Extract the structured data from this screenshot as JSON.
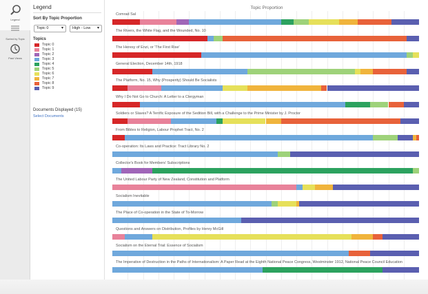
{
  "rail": {
    "legend_label": "Legend",
    "sort_label": "Sorted by Topic",
    "history_label": "Past Views"
  },
  "legend": {
    "title": "Legend",
    "sort_heading": "Sort By Topic Proportion",
    "sort_topic_value": "Topic 0",
    "sort_order_value": "High - Low",
    "topics_heading": "Topics",
    "docs_displayed": "Documents Displayed (15)",
    "select_documents": "Select Documents"
  },
  "topics": [
    {
      "name": "Topic 0",
      "color": "#d62728"
    },
    {
      "name": "Topic 1",
      "color": "#e8829a"
    },
    {
      "name": "Topic 2",
      "color": "#a066b8"
    },
    {
      "name": "Topic 3",
      "color": "#6fa8dc"
    },
    {
      "name": "Topic 4",
      "color": "#2ca25f"
    },
    {
      "name": "Topic 5",
      "color": "#9ed27a"
    },
    {
      "name": "Topic 6",
      "color": "#e6e05a"
    },
    {
      "name": "Topic 7",
      "color": "#f0b43c"
    },
    {
      "name": "Topic 8",
      "color": "#e8623a"
    },
    {
      "name": "Topic 9",
      "color": "#5a5fb0"
    }
  ],
  "main": {
    "heading": "Topic Proportion"
  },
  "chart_data": {
    "type": "bar",
    "stacked": true,
    "orientation": "horizontal",
    "title": "Topic Proportion",
    "xlim": [
      0,
      1
    ],
    "grid": true,
    "documents": [
      {
        "title": "Comrad Sal",
        "segments": [
          [
            0,
            0.09
          ],
          [
            1,
            0.12
          ],
          [
            2,
            0.04
          ],
          [
            3,
            0.3
          ],
          [
            4,
            0.04
          ],
          [
            5,
            0.05
          ],
          [
            6,
            0.1
          ],
          [
            7,
            0.06
          ],
          [
            8,
            0.11
          ],
          [
            9,
            0.09
          ]
        ]
      },
      {
        "title": "The Rivers, the White Flag, and the Wounded, No. 10",
        "segments": [
          [
            0,
            0.31
          ],
          [
            3,
            0.02
          ],
          [
            5,
            0.03
          ],
          [
            8,
            0.6
          ],
          [
            9,
            0.04
          ]
        ]
      },
      {
        "title": "The Heresy of Enzi, or 'The First Rise'",
        "segments": [
          [
            0,
            0.29
          ],
          [
            3,
            0.67
          ],
          [
            5,
            0.02
          ],
          [
            6,
            0.02
          ]
        ]
      },
      {
        "title": "General Election, December 14th, 1918",
        "segments": [
          [
            0,
            0.13
          ],
          [
            3,
            0.31
          ],
          [
            5,
            0.35
          ],
          [
            6,
            0.02
          ],
          [
            7,
            0.04
          ],
          [
            8,
            0.11
          ],
          [
            9,
            0.04
          ]
        ]
      },
      {
        "title": "The Platform, No. 15, Why (Prosperity) Should Be Socialists",
        "segments": [
          [
            0,
            0.05
          ],
          [
            1,
            0.11
          ],
          [
            3,
            0.2
          ],
          [
            6,
            0.08
          ],
          [
            7,
            0.24
          ],
          [
            8,
            0.02
          ],
          [
            9,
            0.3
          ]
        ]
      },
      {
        "title": "Why I Do Not Go to Church: A Letter to a Clergyman",
        "segments": [
          [
            0,
            0.09
          ],
          [
            3,
            0.67
          ],
          [
            4,
            0.08
          ],
          [
            5,
            0.06
          ],
          [
            8,
            0.05
          ],
          [
            9,
            0.05
          ]
        ]
      },
      {
        "title": "Soldiers or Slaves? A Terrific Exposure of the Sedition Bill, with a Challenge to the Prime Minister by J. Proctor",
        "segments": [
          [
            0,
            0.05
          ],
          [
            1,
            0.14
          ],
          [
            3,
            0.15
          ],
          [
            4,
            0.02
          ],
          [
            6,
            0.14
          ],
          [
            7,
            0.05
          ],
          [
            8,
            0.39
          ],
          [
            9,
            0.06
          ]
        ]
      },
      {
        "title": "From Bibles to Religion, Labour Prophet Tract, No. 2",
        "segments": [
          [
            0,
            0.04
          ],
          [
            3,
            0.81
          ],
          [
            5,
            0.08
          ],
          [
            9,
            0.05
          ],
          [
            7,
            0.01
          ],
          [
            8,
            0.01
          ]
        ]
      },
      {
        "title": "Co-operation: Its Laws and Practice: Tract Library No. 2",
        "segments": [
          [
            3,
            0.54
          ],
          [
            5,
            0.04
          ],
          [
            9,
            0.42
          ]
        ]
      },
      {
        "title": "Collector's Book for Members' Subscriptions",
        "segments": [
          [
            3,
            0.03
          ],
          [
            2,
            0.1
          ],
          [
            4,
            0.85
          ],
          [
            5,
            0.02
          ]
        ]
      },
      {
        "title": "The United Labour Party of New Zealand, Constitution and Platform",
        "segments": [
          [
            1,
            0.6
          ],
          [
            3,
            0.02
          ],
          [
            6,
            0.04
          ],
          [
            7,
            0.06
          ],
          [
            9,
            0.28
          ]
        ]
      },
      {
        "title": "Socialism Inevitable",
        "segments": [
          [
            3,
            0.52
          ],
          [
            5,
            0.02
          ],
          [
            6,
            0.06
          ],
          [
            7,
            0.01
          ],
          [
            9,
            0.39
          ]
        ]
      },
      {
        "title": "The Place of Co-operation in the State of To-Morrow",
        "segments": [
          [
            3,
            0.42
          ],
          [
            9,
            0.58
          ]
        ]
      },
      {
        "title": "Questions and Answers on Distribution, Profiles by Henry McGill",
        "segments": [
          [
            1,
            0.04
          ],
          [
            3,
            0.09
          ],
          [
            6,
            0.65
          ],
          [
            7,
            0.07
          ],
          [
            8,
            0.03
          ],
          [
            9,
            0.12
          ]
        ]
      },
      {
        "title": "Socialism on the Eternal Trial: Essence of Socialism",
        "segments": [
          [
            3,
            0.77
          ],
          [
            8,
            0.07
          ],
          [
            9,
            0.16
          ]
        ]
      },
      {
        "title": "The Imperative of Destruction in the Paths of Internationalism: A Paper Read at the Eighth National Peace Congress, Westminster 1912, National Peace Council Education",
        "segments": [
          [
            3,
            0.49
          ],
          [
            4,
            0.39
          ],
          [
            9,
            0.12
          ]
        ]
      }
    ]
  }
}
